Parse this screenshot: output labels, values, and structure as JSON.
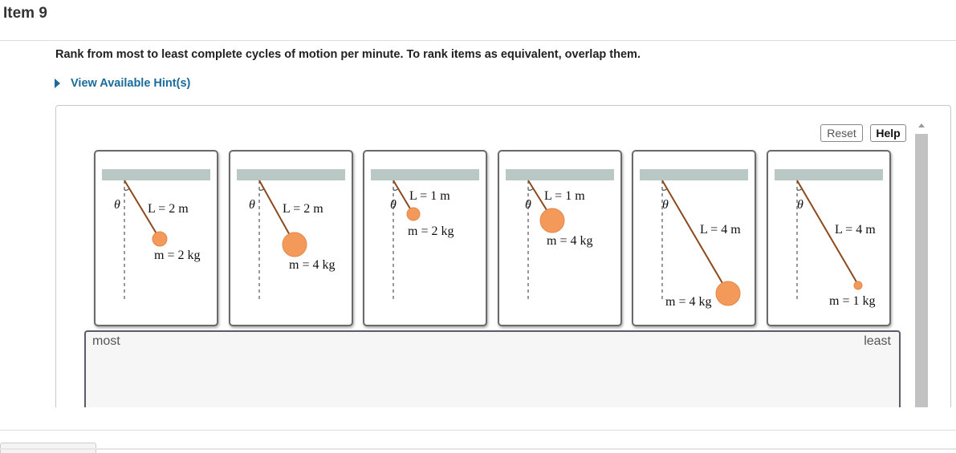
{
  "item": {
    "title": "Item 9"
  },
  "prompt": "Rank from most to least complete cycles of motion per minute. To rank items as equivalent, overlap them.",
  "hint": {
    "label": "View Available Hint(s)"
  },
  "toolbar": {
    "reset_label": "Reset",
    "help_label": "Help"
  },
  "cards": [
    {
      "length_label": "L = 2 m",
      "mass_label": "m = 2 kg",
      "angle_symbol": "θ"
    },
    {
      "length_label": "L = 2 m",
      "mass_label": "m = 4 kg",
      "angle_symbol": "θ"
    },
    {
      "length_label": "L = 1 m",
      "mass_label": "m = 2 kg",
      "angle_symbol": "θ"
    },
    {
      "length_label": "L = 1 m",
      "mass_label": "m = 4 kg",
      "angle_symbol": "θ"
    },
    {
      "length_label": "L = 4 m",
      "mass_label": "m = 4 kg",
      "angle_symbol": "θ"
    },
    {
      "length_label": "L = 4 m",
      "mass_label": "m = 1 kg",
      "angle_symbol": "θ"
    }
  ],
  "ranking": {
    "most_label": "most",
    "least_label": "least"
  },
  "colors": {
    "link": "#1a6b9a",
    "bob": "#f39a5a",
    "string": "#8b4a1e",
    "ceiling": "#b9c7c5"
  }
}
